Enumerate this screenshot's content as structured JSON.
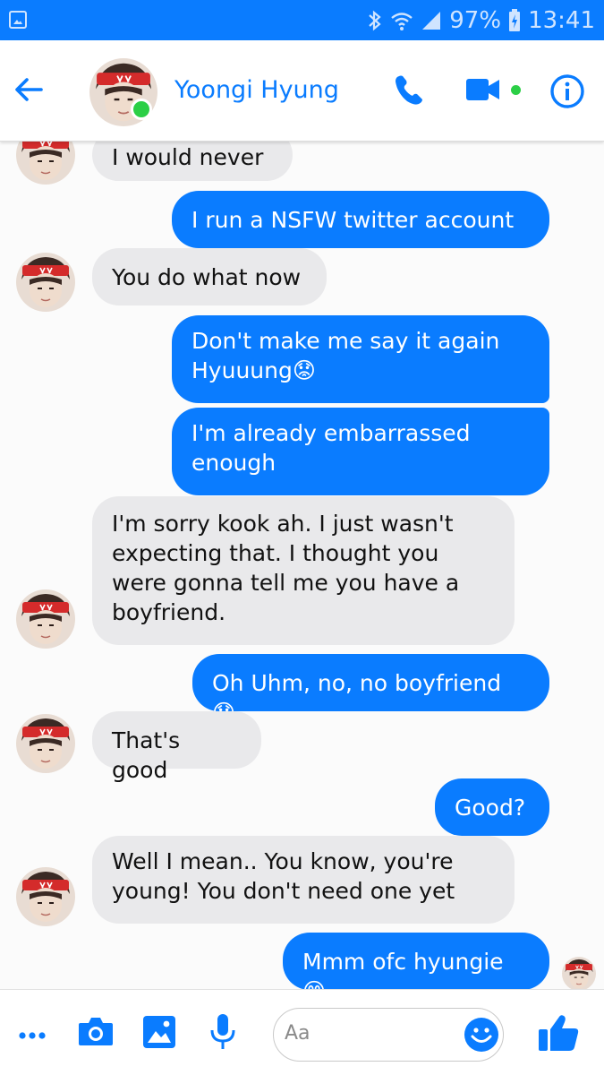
{
  "status_bar": {
    "battery": "97%",
    "time": "13:41",
    "icons": [
      "gallery-icon",
      "bluetooth-icon",
      "wifi-icon",
      "signal-icon",
      "battery-charging-icon"
    ]
  },
  "header": {
    "contact_name": "Yoongi Hyung",
    "icons": [
      "back-arrow-icon",
      "phone-icon",
      "video-camera-icon",
      "info-icon"
    ],
    "accent": "#0a7cff",
    "online_color": "#2bcf46"
  },
  "messages": [
    {
      "from": "them",
      "text": "I would never"
    },
    {
      "from": "me",
      "text": "I run a NSFW twitter account"
    },
    {
      "from": "them",
      "text": "You do what now"
    },
    {
      "from": "me",
      "text": "Don't make me say it again Hyuuung😟"
    },
    {
      "from": "me",
      "text": "I'm already embarrassed enough"
    },
    {
      "from": "them",
      "text": "I'm sorry kook ah. I just wasn't expecting that. I thought you were gonna tell me you have a boyfriend."
    },
    {
      "from": "me",
      "text": "Oh Uhm, no, no boyfriend 😟"
    },
    {
      "from": "them",
      "text": "That's good"
    },
    {
      "from": "me",
      "text": "Good?"
    },
    {
      "from": "them",
      "text": "Well I mean.. You know, you're young! You don't need one yet"
    },
    {
      "from": "me",
      "text": "Mmm ofc hyungie 😊"
    }
  ],
  "composer": {
    "placeholder": "Aa",
    "icons": [
      "more-icon",
      "camera-icon",
      "image-icon",
      "microphone-icon",
      "emoji-icon",
      "thumbs-up-icon"
    ]
  },
  "colors": {
    "outgoing_bubble": "#0a7cff",
    "incoming_bubble": "#e9e9eb"
  }
}
